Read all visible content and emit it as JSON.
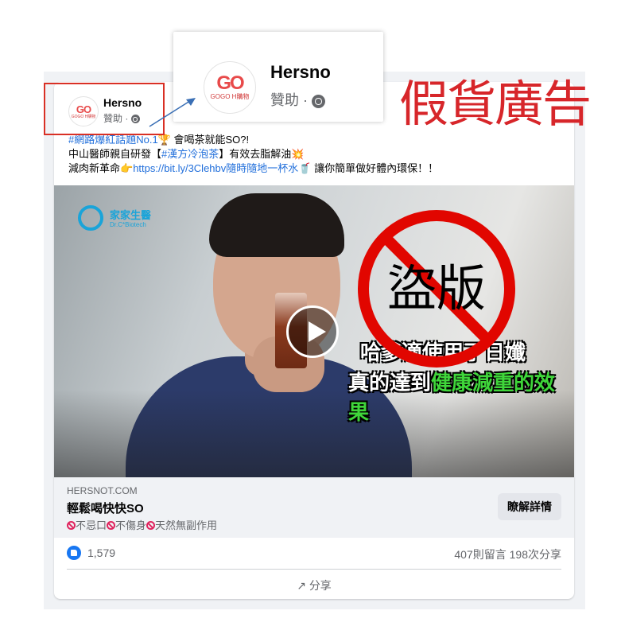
{
  "overlay": {
    "fake_ad_label": "假貨廣告"
  },
  "page": {
    "name": "Hersno",
    "sponsored": "贊助 ·",
    "logo_text": "GO",
    "logo_sub": "GOGO H購物"
  },
  "post": {
    "line1_tag": "#網路爆紅話題No.1",
    "line1_emoji": "🏆",
    "line1_text": " 會喝茶就能SO?!",
    "line2_prefix": "中山醫師親自研發【",
    "line2_tag": "#漢方冷泡茶",
    "line2_suffix": "】有效去脂解油",
    "line2_emoji": "💥",
    "line3_prefix": "減肉新革命",
    "line3_emoji": "👉",
    "line3_link": "https://bit.ly/3Clehbv隨時隨地一杯水",
    "line3_emoji2": "🥤",
    "line3_suffix": " 讓你簡單做好體內環保！！"
  },
  "video": {
    "brand_name": "家家生醫",
    "brand_sub": "Dr.C*Biotech",
    "caption_line1": "哈爹適使用了日孅",
    "caption_line2_white": "真的達到",
    "caption_line2_green": "健康減重的效果",
    "stamp_text": "盜版"
  },
  "link_preview": {
    "domain": "HERSNOT.COM",
    "title": "輕鬆喝快快SO",
    "desc_items": [
      "不忌口",
      "不傷身",
      "天然無副作用"
    ],
    "cta_label": "瞭解詳情"
  },
  "reactions": {
    "like_count": "1,579",
    "comments_shares": "407則留言  198次分享"
  },
  "actions": {
    "share_label": "分享",
    "share_icon": "↗"
  },
  "colors": {
    "accent_red": "#d7262a",
    "link_blue": "#216fdb",
    "fb_blue": "#1877f2"
  }
}
